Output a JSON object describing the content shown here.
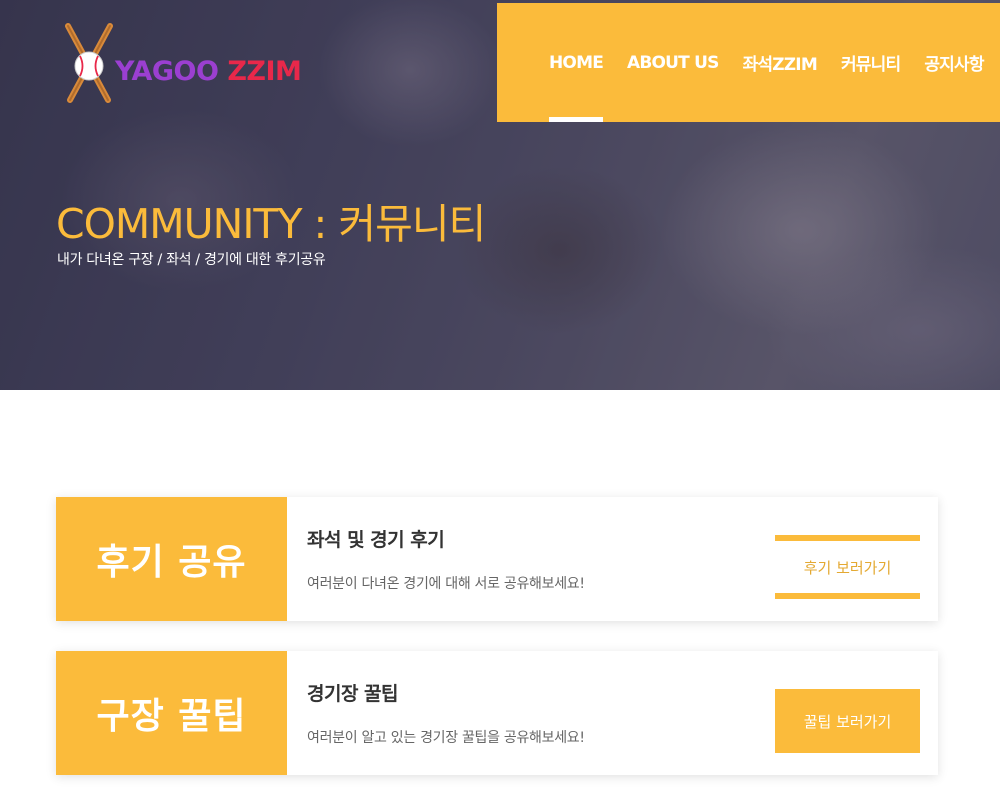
{
  "brand": {
    "logo_word1": "YAGOO",
    "logo_word2": "ZZIM",
    "logo_icon": "baseball-crossed-bats-icon",
    "colors": {
      "purple": "#9b3fd1",
      "red": "#e8284a"
    }
  },
  "nav": {
    "items": [
      {
        "label": "HOME",
        "active": true
      },
      {
        "label": "ABOUT US",
        "active": false
      },
      {
        "label": "좌석ZZIM",
        "active": false
      },
      {
        "label": "커뮤니티",
        "active": false
      },
      {
        "label": "공지사항",
        "active": false
      }
    ]
  },
  "hero": {
    "title": "COMMUNITY : 커뮤니티",
    "subtitle": "내가 다녀온 구장 / 좌석 / 경기에 대한 후기공유"
  },
  "cards": [
    {
      "label": "후기 공유",
      "title": "좌석 및 경기 후기",
      "description": "여러분이 다녀온 경기에 대해 서로 공유해보세요!",
      "button": "후기 보러가기",
      "button_style": "outline"
    },
    {
      "label": "구장 꿀팁",
      "title": "경기장 꿀팁",
      "description": "여러분이 알고 있는 경기장 꿀팁을 공유해보세요!",
      "button": "꿀팁 보러가기",
      "button_style": "filled"
    }
  ],
  "colors": {
    "accent": "#fbbb3b",
    "text_dark": "#333333",
    "text_muted": "#666666"
  }
}
